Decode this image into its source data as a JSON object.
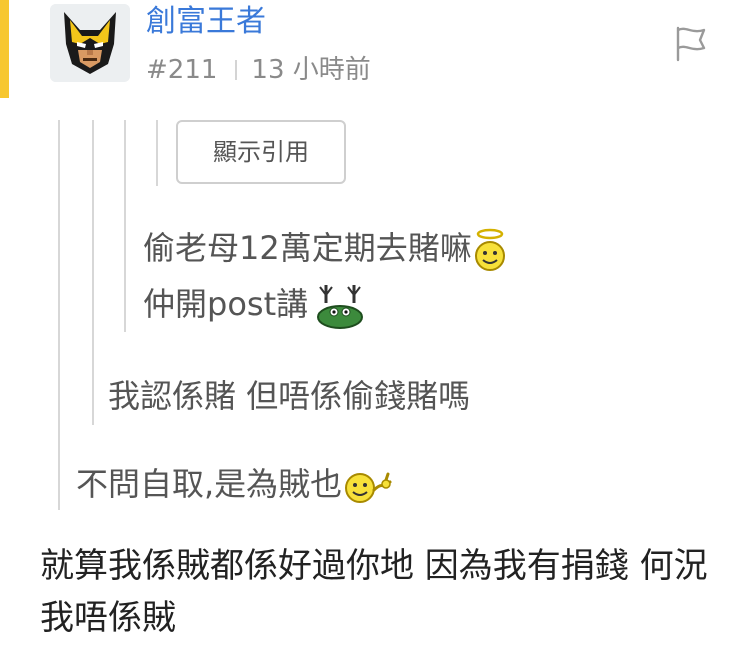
{
  "post": {
    "username": "創富王者",
    "floor": "#211",
    "time": "13 小時前"
  },
  "quotes": {
    "show_quote_label": "顯示引用",
    "level3_line1": "偷老母12萬定期去賭嘛",
    "level3_line2": "仲開post講",
    "level2": "我認係賭 但唔係偷錢賭嗎",
    "level1": "不問自取,是為賊也"
  },
  "reply": {
    "text": "就算我係賊都係好過你地 因為我有捐錢 何況我唔係賊"
  },
  "icons": [
    "wolverine-avatar",
    "flag-icon",
    "angel-smiley-icon",
    "alien-frog-icon",
    "hello-smiley-icon"
  ],
  "colors": {
    "accent": "#f7c72f",
    "username": "#3a79d9",
    "meta": "#8a8a8a",
    "quote_text": "#555555",
    "quote_line": "#d7d7d7"
  }
}
